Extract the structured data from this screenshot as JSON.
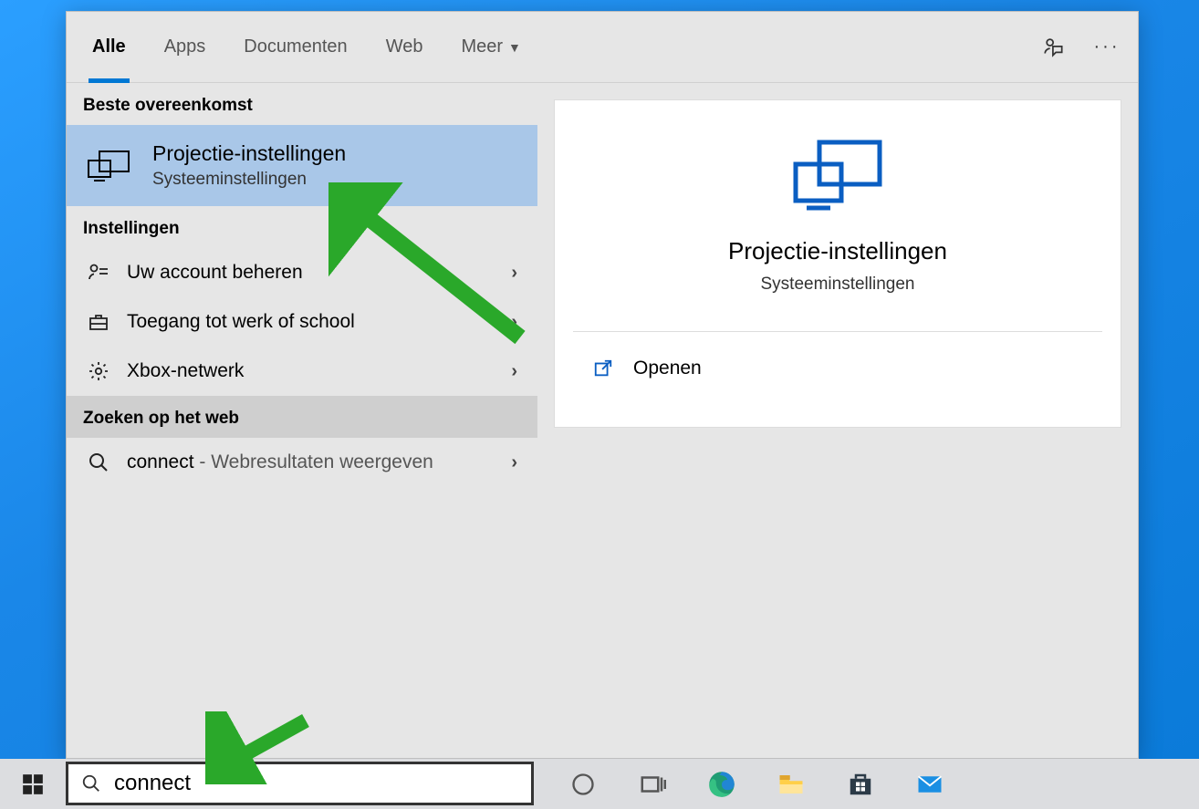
{
  "tabs": {
    "all": "Alle",
    "apps": "Apps",
    "documents": "Documenten",
    "web": "Web",
    "more": "Meer"
  },
  "sections": {
    "best": "Beste overeenkomst",
    "settings": "Instellingen",
    "websearch": "Zoeken op het web"
  },
  "best_match": {
    "title": "Projectie-instellingen",
    "sub": "Systeeminstellingen"
  },
  "settings_rows": [
    {
      "label": "Uw account beheren"
    },
    {
      "label": "Toegang tot werk of school"
    },
    {
      "label": "Xbox-netwerk"
    }
  ],
  "web_row": {
    "term": "connect",
    "suffix": " - Webresultaten weergeven"
  },
  "preview": {
    "title": "Projectie-instellingen",
    "sub": "Systeeminstellingen",
    "open": "Openen"
  },
  "search": {
    "value": "connect"
  }
}
